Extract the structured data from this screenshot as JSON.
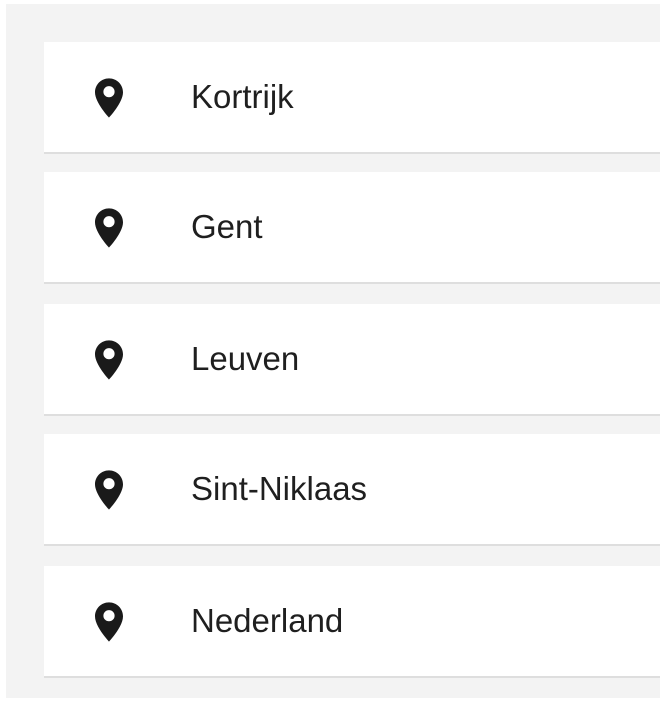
{
  "locations": [
    {
      "label": "Kortrijk",
      "icon": "map-pin-icon"
    },
    {
      "label": "Gent",
      "icon": "map-pin-icon"
    },
    {
      "label": "Leuven",
      "icon": "map-pin-icon"
    },
    {
      "label": "Sint-Niklaas",
      "icon": "map-pin-icon"
    },
    {
      "label": "Nederland",
      "icon": "map-pin-icon"
    }
  ],
  "colors": {
    "background": "#f3f3f3",
    "card": "#ffffff",
    "divider": "#dedede",
    "text": "#1f1f1f",
    "icon": "#1a1a1a"
  }
}
